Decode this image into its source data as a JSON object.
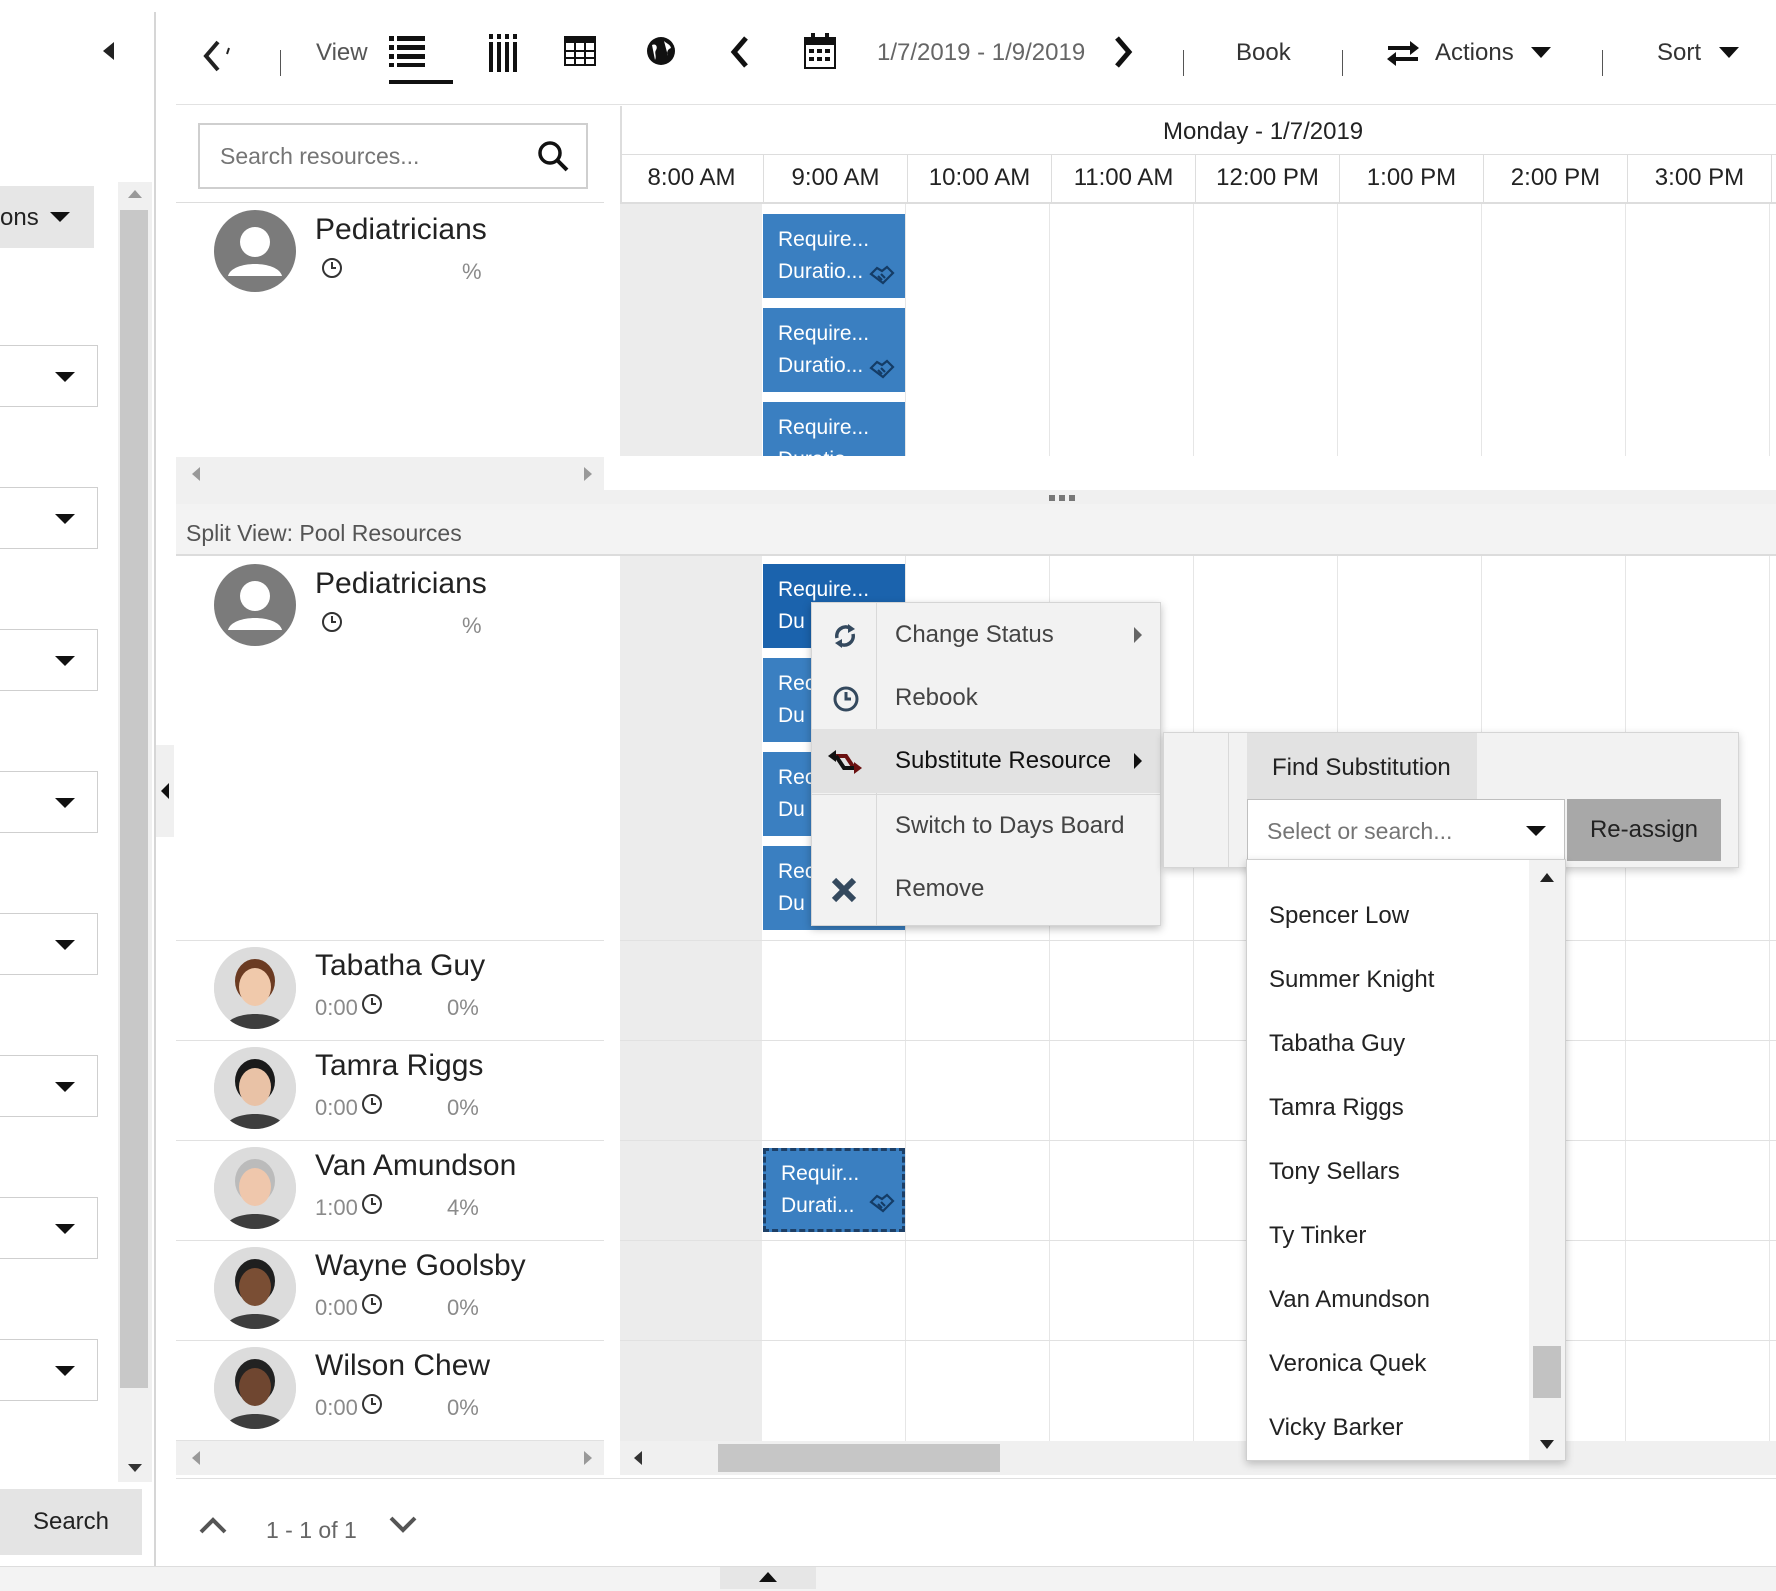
{
  "toolbar": {
    "view_label": "View",
    "date_range": "1/7/2019 - 1/9/2019",
    "book_label": "Book",
    "actions_label": "Actions",
    "sort_label": "Sort"
  },
  "left_panel": {
    "partial_label": "ons",
    "search_button": "Search"
  },
  "search": {
    "placeholder": "Search resources..."
  },
  "timeline": {
    "date_header": "Monday - 1/7/2019",
    "hours": [
      "8:00 AM",
      "9:00 AM",
      "10:00 AM",
      "11:00 AM",
      "12:00 PM",
      "1:00 PM",
      "2:00 PM",
      "3:00 PM"
    ]
  },
  "top_pane": {
    "resource": {
      "name": "Pediatricians",
      "percent": "%"
    },
    "bookings": [
      {
        "line1": "Require...",
        "line2": "Duratio..."
      },
      {
        "line1": "Require...",
        "line2": "Duratio..."
      },
      {
        "line1": "Require...",
        "line2": "Duratio..."
      }
    ]
  },
  "split_view": {
    "label": "Split View: Pool Resources",
    "pool": {
      "name": "Pediatricians",
      "percent": "%"
    },
    "bookings": [
      {
        "line1": "Require...",
        "line2": "Du"
      },
      {
        "line1": "Rec",
        "line2": "Du"
      },
      {
        "line1": "Rec",
        "line2": "Du"
      },
      {
        "line1": "Rec",
        "line2": "Du"
      }
    ],
    "resources": [
      {
        "name": "Tabatha Guy",
        "hours": "0:00",
        "percent": "0%"
      },
      {
        "name": "Tamra Riggs",
        "hours": "0:00",
        "percent": "0%"
      },
      {
        "name": "Van Amundson",
        "hours": "1:00",
        "percent": "4%"
      },
      {
        "name": "Wayne Goolsby",
        "hours": "0:00",
        "percent": "0%"
      },
      {
        "name": "Wilson Chew",
        "hours": "0:00",
        "percent": "0%"
      }
    ],
    "selected_booking": {
      "line1": "Requir...",
      "line2": "Durati..."
    }
  },
  "context_menu": {
    "items": [
      {
        "label": "Change Status",
        "icon": "refresh-icon",
        "submenu": true
      },
      {
        "label": "Rebook",
        "icon": "clock-icon",
        "submenu": false
      },
      {
        "label": "Substitute Resource",
        "icon": "swap-icon",
        "submenu": true,
        "highlighted": true
      },
      {
        "label": "Switch to Days Board",
        "icon": "",
        "submenu": false
      },
      {
        "label": "Remove",
        "icon": "close-icon",
        "submenu": false
      }
    ]
  },
  "substitute_panel": {
    "tab_label": "Find Substitution",
    "select_placeholder": "Select or search...",
    "reassign_label": "Re-assign"
  },
  "dropdown_options": [
    "Spencer Low",
    "Summer Knight",
    "Tabatha Guy",
    "Tamra Riggs",
    "Tony Sellars",
    "Ty Tinker",
    "Van Amundson",
    "Veronica Quek",
    "Vicky Barker"
  ],
  "pagination": {
    "text": "1 - 1 of 1"
  },
  "colors": {
    "booking": "#3a7fc1",
    "booking_selected": "#1b63ad",
    "menu_highlight": "#e2e2e2"
  }
}
